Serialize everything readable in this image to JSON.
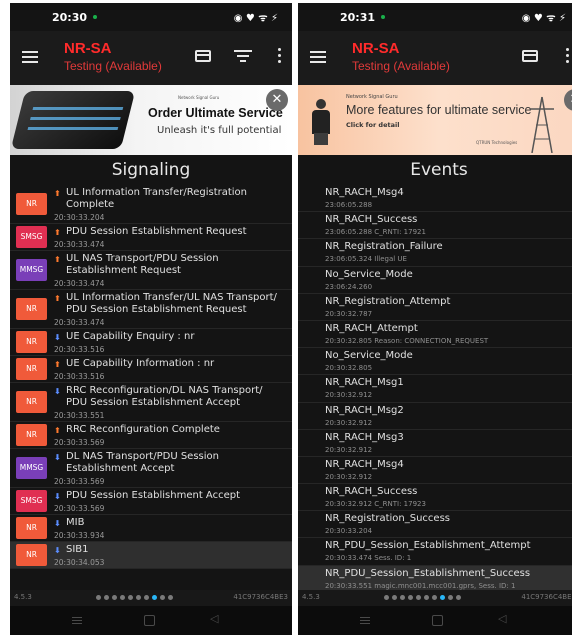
{
  "left": {
    "status": {
      "time": "20:30",
      "status_icons": "◉ ♥ ᯤ ⚡"
    },
    "app": {
      "title": "NR-SA",
      "subtitle": "Testing (Available)"
    },
    "ad": {
      "brand": "Network Signal Guru",
      "headline": "Order Ultimate Service",
      "tagline": "Unleash it's full potential"
    },
    "section_title": "Signaling",
    "items": [
      {
        "badge": "NR",
        "badge_color": "#f05a3a",
        "dir": "up",
        "title": "UL Information Transfer/Registration Complete",
        "time": "20:30:33.204"
      },
      {
        "badge": "SMSG",
        "badge_color": "#e02f52",
        "dir": "up",
        "title": "PDU Session Establishment Request",
        "time": "20:30:33.474"
      },
      {
        "badge": "MMSG",
        "badge_color": "#7a3fb8",
        "dir": "up",
        "title": "UL NAS Transport/PDU Session Establishment Request",
        "time": "20:30:33.474"
      },
      {
        "badge": "NR",
        "badge_color": "#f05a3a",
        "dir": "up",
        "title": "UL Information Transfer/UL NAS Transport/ PDU Session Establishment Request",
        "time": "20:30:33.474"
      },
      {
        "badge": "NR",
        "badge_color": "#f05a3a",
        "dir": "down",
        "title": "UE Capability Enquiry : nr",
        "time": "20:30:33.516"
      },
      {
        "badge": "NR",
        "badge_color": "#f05a3a",
        "dir": "up",
        "title": "UE Capability Information : nr",
        "time": "20:30:33.516"
      },
      {
        "badge": "NR",
        "badge_color": "#f05a3a",
        "dir": "down",
        "title": "RRC Reconfiguration/DL NAS Transport/ PDU Session Establishment Accept",
        "time": "20:30:33.551"
      },
      {
        "badge": "NR",
        "badge_color": "#f05a3a",
        "dir": "up",
        "title": "RRC Reconfiguration Complete",
        "time": "20:30:33.569"
      },
      {
        "badge": "MMSG",
        "badge_color": "#7a3fb8",
        "dir": "down",
        "title": "DL NAS Transport/PDU Session Establishment Accept",
        "time": "20:30:33.569"
      },
      {
        "badge": "SMSG",
        "badge_color": "#e02f52",
        "dir": "down",
        "title": "PDU Session Establishment Accept",
        "time": "20:30:33.569"
      },
      {
        "badge": "NR",
        "badge_color": "#f05a3a",
        "dir": "down",
        "title": "MIB",
        "time": "20:30:33.934"
      },
      {
        "badge": "NR",
        "badge_color": "#f05a3a",
        "dir": "down",
        "title": "SIB1",
        "time": "20:30:34.053"
      }
    ],
    "pager": {
      "version": "4.5.3",
      "device_id": "41C9736C4BE3",
      "active_index": 7,
      "count": 10
    }
  },
  "right": {
    "status": {
      "time": "20:31",
      "status_icons": "◉ ♥ ᯤ ⚡"
    },
    "app": {
      "title": "NR-SA",
      "subtitle": "Testing (Available)"
    },
    "ad": {
      "brand": "Network Signal Guru",
      "headline": "More features for ultimate service",
      "link": "Click for detail",
      "company": "QTRUN Technologies"
    },
    "section_title": "Events",
    "items": [
      {
        "title": "NR_RACH_Msg4",
        "sub": "23:06:05.288"
      },
      {
        "title": "NR_RACH_Success",
        "sub": "23:06:05.288    C_RNTI: 17921"
      },
      {
        "title": "NR_Registration_Failure",
        "sub": "23:06:05.324    Illegal UE"
      },
      {
        "title": "No_Service_Mode",
        "sub": "23:06:24.260"
      },
      {
        "title": "NR_Registration_Attempt",
        "sub": "20:30:32.787"
      },
      {
        "title": "NR_RACH_Attempt",
        "sub": "20:30:32.805    Reason: CONNECTION_REQUEST"
      },
      {
        "title": "No_Service_Mode",
        "sub": "20:30:32.805"
      },
      {
        "title": "NR_RACH_Msg1",
        "sub": "20:30:32.912"
      },
      {
        "title": "NR_RACH_Msg2",
        "sub": "20:30:32.912"
      },
      {
        "title": "NR_RACH_Msg3",
        "sub": "20:30:32.912"
      },
      {
        "title": "NR_RACH_Msg4",
        "sub": "20:30:32.912"
      },
      {
        "title": "NR_RACH_Success",
        "sub": "20:30:32.912    C_RNTI: 17923"
      },
      {
        "title": "NR_Registration_Success",
        "sub": "20:30:33.204"
      },
      {
        "title": "NR_PDU_Session_Establishment_Attempt",
        "sub": "20:30:33.474    Sess. ID: 1"
      },
      {
        "title": "NR_PDU_Session_Establishment_Success",
        "sub": "20:30:33.551    magic.mnc001.mcc001.gprs, Sess. ID: 1"
      }
    ],
    "pager": {
      "version": "4.5.3",
      "device_id": "41C9736C4BE3",
      "active_index": 7,
      "count": 10
    }
  }
}
